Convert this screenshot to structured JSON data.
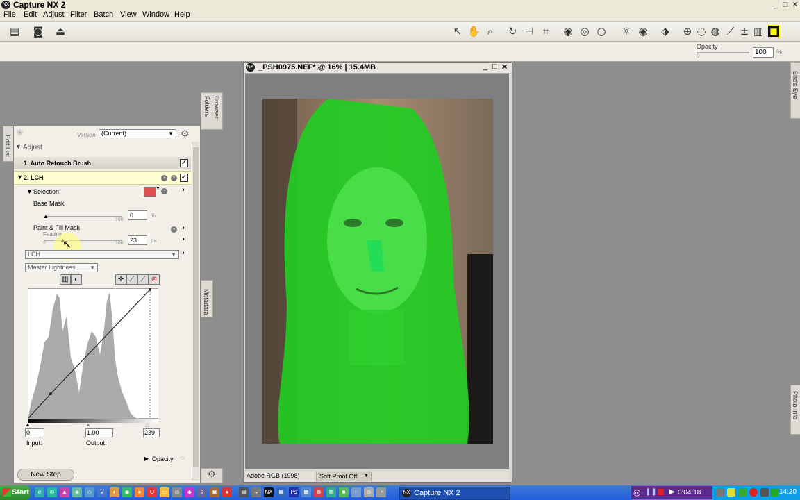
{
  "window": {
    "title": "Capture NX 2",
    "app_icon": "NX",
    "minimize": "_",
    "restore": "□",
    "close": "✕"
  },
  "menu": [
    "File",
    "Edit",
    "Adjust",
    "Filter",
    "Batch",
    "View",
    "Window",
    "Help"
  ],
  "options_bar": {
    "opacity_label": "Opacity",
    "opacity_min": "0",
    "opacity_value": "100",
    "opacity_unit": "%"
  },
  "side_tabs": {
    "browser": "Browser",
    "folders": "Folders",
    "metadata": "Metadata",
    "birds_eye": "Bird's Eye",
    "photo_info": "Photo Info",
    "edit_list": "Edit List"
  },
  "edit_list": {
    "version_label": "Version",
    "version_value": "(Current)",
    "adjust_header": "Adjust",
    "step1": "1. Auto Retouch Brush",
    "step2": "2. LCH",
    "selection_label": "Selection",
    "base_mask_label": "Base Mask",
    "base_mask_value": "0",
    "base_mask_unit": "%",
    "base_mask_max": "100",
    "paint_fill_label": "Paint & Fill Mask",
    "feather_label": "Feather",
    "feather_min": "0",
    "feather_max": "100",
    "feather_value": "23",
    "feather_unit": "px",
    "lch_select": "LCH",
    "channel_select": "Master Lightness",
    "input_label": "Input:",
    "output_label": "Output:",
    "input_low": "0",
    "gamma": "1.00",
    "input_high": "239",
    "opacity_label": "Opacity",
    "new_step": "New Step"
  },
  "image_window": {
    "title": "_PSH0975.NEF* @ 16% | 15.4MB",
    "color_space": "Adobe RGB (1998)",
    "soft_proof": "Soft Proof Off"
  },
  "taskbar": {
    "start": "Start",
    "active_task": "Capture NX 2",
    "recorder_time": "0:04:18",
    "clock": "14:20"
  },
  "colors": {
    "mask_green": "#22cc22",
    "taskbar_blue": "#245edb",
    "tray_blue": "#0f9ee8",
    "start_green": "#2c8a2c"
  }
}
